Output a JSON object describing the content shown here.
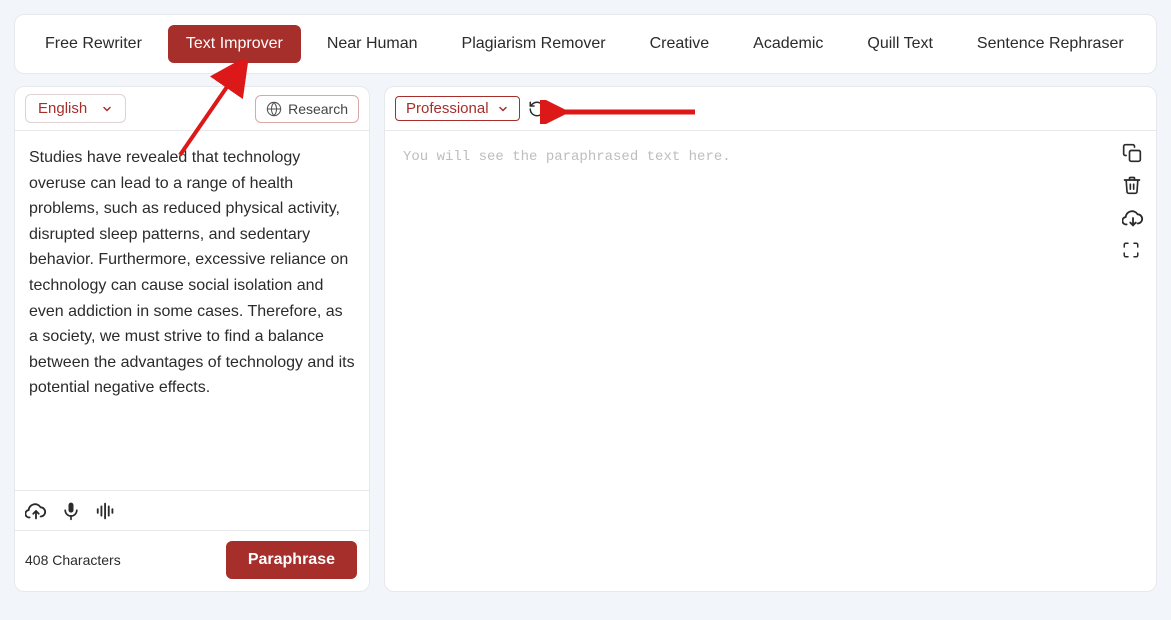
{
  "tabs": [
    {
      "label": "Free Rewriter",
      "active": false
    },
    {
      "label": "Text Improver",
      "active": true
    },
    {
      "label": "Near Human",
      "active": false
    },
    {
      "label": "Plagiarism Remover",
      "active": false
    },
    {
      "label": "Creative",
      "active": false
    },
    {
      "label": "Academic",
      "active": false
    },
    {
      "label": "Quill Text",
      "active": false
    },
    {
      "label": "Sentence Rephraser",
      "active": false
    }
  ],
  "left": {
    "language": "English",
    "research_label": "Research",
    "input_text": "Studies have revealed that technology overuse can lead to a range of health problems, such as reduced physical activity, disrupted sleep patterns, and sedentary behavior. Furthermore, excessive reliance on technology can cause social isolation and even addiction in some cases. Therefore, as a society, we must strive to find a balance between the advantages of technology and its potential negative effects.",
    "char_count_label": "408 Characters",
    "paraphrase_label": "Paraphrase"
  },
  "right": {
    "style": "Professional",
    "placeholder": "You will see the paraphrased text here."
  },
  "colors": {
    "accent": "#a62f2b",
    "bg": "#f2f6fb",
    "annotation": "#dc1818"
  }
}
